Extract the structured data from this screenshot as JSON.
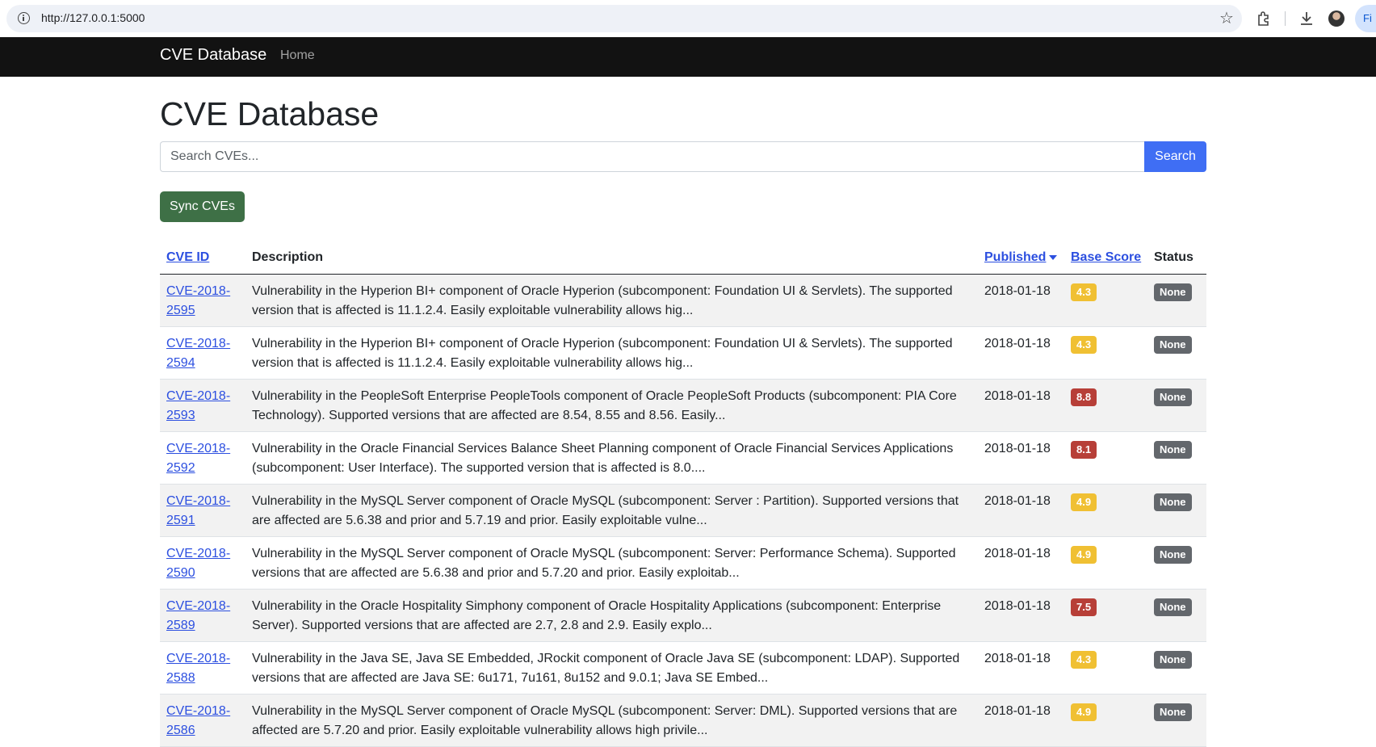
{
  "browser": {
    "url": "http://127.0.0.1:5000",
    "profile_label": "Fi"
  },
  "navbar": {
    "brand": "CVE Database",
    "home": "Home"
  },
  "main": {
    "title": "CVE Database",
    "search_placeholder": "Search CVEs...",
    "search_button": "Search",
    "sync_button": "Sync CVEs"
  },
  "table": {
    "headers": {
      "cve_id": "CVE ID",
      "description": "Description",
      "published": "Published",
      "base_score": "Base Score",
      "status": "Status"
    },
    "rows": [
      {
        "id_line1": "CVE-2018-",
        "id_line2": "2595",
        "description": "Vulnerability in the Hyperion BI+ component of Oracle Hyperion (subcomponent: Foundation UI & Servlets). The supported version that is affected is 11.1.2.4. Easily exploitable vulnerability allows hig...",
        "published": "2018-01-18",
        "score": "4.3",
        "severity": "medium",
        "status": "None"
      },
      {
        "id_line1": "CVE-2018-",
        "id_line2": "2594",
        "description": "Vulnerability in the Hyperion BI+ component of Oracle Hyperion (subcomponent: Foundation UI & Servlets). The supported version that is affected is 11.1.2.4. Easily exploitable vulnerability allows hig...",
        "published": "2018-01-18",
        "score": "4.3",
        "severity": "medium",
        "status": "None"
      },
      {
        "id_line1": "CVE-2018-",
        "id_line2": "2593",
        "description": "Vulnerability in the PeopleSoft Enterprise PeopleTools component of Oracle PeopleSoft Products (subcomponent: PIA Core Technology). Supported versions that are affected are 8.54, 8.55 and 8.56. Easily...",
        "published": "2018-01-18",
        "score": "8.8",
        "severity": "high",
        "status": "None"
      },
      {
        "id_line1": "CVE-2018-",
        "id_line2": "2592",
        "description": "Vulnerability in the Oracle Financial Services Balance Sheet Planning component of Oracle Financial Services Applications (subcomponent: User Interface). The supported version that is affected is 8.0....",
        "published": "2018-01-18",
        "score": "8.1",
        "severity": "high",
        "status": "None"
      },
      {
        "id_line1": "CVE-2018-",
        "id_line2": "2591",
        "description": "Vulnerability in the MySQL Server component of Oracle MySQL (subcomponent: Server : Partition). Supported versions that are affected are 5.6.38 and prior and 5.7.19 and prior. Easily exploitable vulne...",
        "published": "2018-01-18",
        "score": "4.9",
        "severity": "medium",
        "status": "None"
      },
      {
        "id_line1": "CVE-2018-",
        "id_line2": "2590",
        "description": "Vulnerability in the MySQL Server component of Oracle MySQL (subcomponent: Server: Performance Schema). Supported versions that are affected are 5.6.38 and prior and 5.7.20 and prior. Easily exploitab...",
        "published": "2018-01-18",
        "score": "4.9",
        "severity": "medium",
        "status": "None"
      },
      {
        "id_line1": "CVE-2018-",
        "id_line2": "2589",
        "description": "Vulnerability in the Oracle Hospitality Simphony component of Oracle Hospitality Applications (subcomponent: Enterprise Server). Supported versions that are affected are 2.7, 2.8 and 2.9. Easily explo...",
        "published": "2018-01-18",
        "score": "7.5",
        "severity": "high",
        "status": "None"
      },
      {
        "id_line1": "CVE-2018-",
        "id_line2": "2588",
        "description": "Vulnerability in the Java SE, Java SE Embedded, JRockit component of Oracle Java SE (subcomponent: LDAP). Supported versions that are affected are Java SE: 6u171, 7u161, 8u152 and 9.0.1; Java SE Embed...",
        "published": "2018-01-18",
        "score": "4.3",
        "severity": "medium",
        "status": "None"
      },
      {
        "id_line1": "CVE-2018-",
        "id_line2": "2586",
        "description": "Vulnerability in the MySQL Server component of Oracle MySQL (subcomponent: Server: DML). Supported versions that are affected are 5.7.20 and prior. Easily exploitable vulnerability allows high privile...",
        "published": "2018-01-18",
        "score": "4.9",
        "severity": "medium",
        "status": "None"
      }
    ]
  }
}
